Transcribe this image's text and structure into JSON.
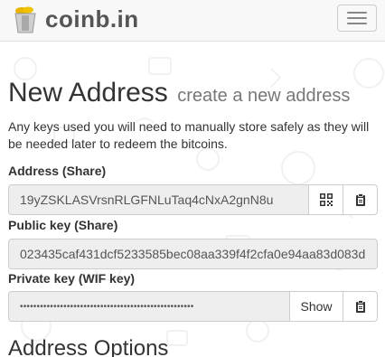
{
  "navbar": {
    "brand": "coinb.in",
    "menu_icon": "hamburger-menu-icon"
  },
  "page": {
    "title": "New Address",
    "subtitle": "create a new address",
    "intro": "Any keys used you will need to manually store safely as they will be needed later to redeem the bitcoins."
  },
  "address": {
    "label": "Address (Share)",
    "value": "19yZSKLASVrsnRLGFNLuTaq4cNxA2gnN8u",
    "qr_icon": "qrcode-icon",
    "copy_icon": "clipboard-icon"
  },
  "pubkey": {
    "label": "Public key (Share)",
    "value": "023435caf431dcf5233585bec08aa339f4f2cfa0e94aa83d083d"
  },
  "privkey": {
    "label": "Private key (WIF key)",
    "masked_value": "••••••••••••••••••••••••••••••••••••••••••••••••••••",
    "show_label": "Show",
    "copy_icon": "clipboard-icon"
  },
  "options": {
    "title": "Address Options"
  },
  "colors": {
    "navbar_bg": "#f8f8f8",
    "readonly_bg": "#eeeeee",
    "text": "#333333",
    "muted": "#777777"
  }
}
